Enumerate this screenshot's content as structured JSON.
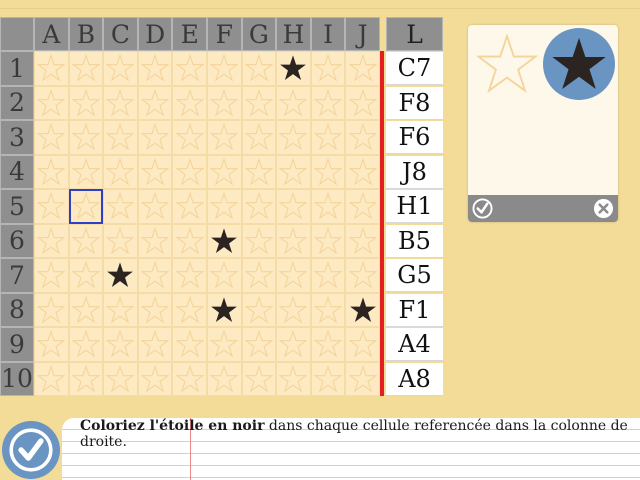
{
  "grid": {
    "columns": [
      "A",
      "B",
      "C",
      "D",
      "E",
      "F",
      "G",
      "H",
      "I",
      "J"
    ],
    "rows": [
      "1",
      "2",
      "3",
      "4",
      "5",
      "6",
      "7",
      "8",
      "9",
      "10"
    ],
    "black_stars": [
      "H1",
      "F6",
      "C7",
      "F8",
      "J8"
    ],
    "selected_cell": "B5"
  },
  "answers": {
    "header": "L",
    "items": [
      "C7",
      "F8",
      "F6",
      "J8",
      "H1",
      "B5",
      "G5",
      "F1",
      "A4",
      "A8"
    ]
  },
  "picker": {
    "options": [
      "empty-star",
      "black-star"
    ],
    "selected": "black-star"
  },
  "colors": {
    "header_gray": "#8f8f8f",
    "cell_bg": "#fdeac3",
    "star_outline": "#f4d49a",
    "star_black": "#2b2421",
    "accent_blue": "#6a94c2",
    "selection_blue": "#2f3fc8",
    "red_rule": "#e51f1f"
  },
  "instruction": {
    "bold": "Coloriez l'étoile en noir",
    "rest": " dans chaque cellule referencée dans la colonne de droite."
  }
}
